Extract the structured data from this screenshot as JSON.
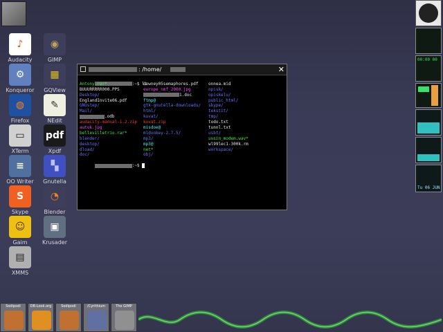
{
  "desktop": {
    "icons": [
      {
        "label": "Audacity",
        "glyph": "♪",
        "bg": "#ffffff",
        "fg": "#e05010"
      },
      {
        "label": "GIMP",
        "glyph": "◉",
        "bg": "#3d3e5a",
        "fg": "#c0a060"
      },
      {
        "label": "Konqueror",
        "glyph": "⚙",
        "bg": "#6080c0",
        "fg": "#ffffff"
      },
      {
        "label": "GQView",
        "glyph": "▦",
        "bg": "#3d3e5a",
        "fg": "#e0c020"
      },
      {
        "label": "Firefox",
        "glyph": "◍",
        "bg": "#2050a0",
        "fg": "#ff8020"
      },
      {
        "label": "NEdit",
        "glyph": "✎",
        "bg": "#f0f0e0",
        "fg": "#303030"
      },
      {
        "label": "XTerm",
        "glyph": "▭",
        "bg": "#d0d0d0",
        "fg": "#202020"
      },
      {
        "label": "Xpdf",
        "glyph": "pdf",
        "bg": "#1a1a1a",
        "fg": "#ffffff"
      },
      {
        "label": "OO Writer",
        "glyph": "≡",
        "bg": "#5070a0",
        "fg": "#ffffff"
      },
      {
        "label": "Gnutella",
        "glyph": "▚",
        "bg": "#4050c0",
        "fg": "#c0c0ff"
      },
      {
        "label": "Skype",
        "glyph": "S",
        "bg": "#f06020",
        "fg": "#ffffff"
      },
      {
        "label": "Blender",
        "glyph": "◔",
        "bg": "#3d3e5a",
        "fg": "#f08020"
      },
      {
        "label": "Gaim",
        "glyph": "☺",
        "bg": "#f0c010",
        "fg": "#503000"
      },
      {
        "label": "Krusader",
        "glyph": "▣",
        "bg": "#607080",
        "fg": "#ffffff"
      },
      {
        "label": "XMMS",
        "glyph": "▤",
        "bg": "#b0b0b0",
        "fg": "#202020"
      }
    ]
  },
  "terminal": {
    "title": ": /home/",
    "close": "✕",
    "prompt1": ":~$ ls",
    "prompt2": ":~$",
    "col1": [
      {
        "t": "Antony.rar*",
        "c": "c-green"
      },
      {
        "t": "BUUURRRRR000.PPS",
        "c": "c-white"
      },
      {
        "t": "Desktop/",
        "c": "c-blue"
      },
      {
        "t": "EnglandInvite06.pdf",
        "c": "c-white"
      },
      {
        "t": "GNUstep/",
        "c": "c-blue"
      },
      {
        "t": "Mail/",
        "c": "c-blue"
      },
      {
        "t": ".odb",
        "c": "c-white",
        "redact": true
      },
      {
        "t": "audacity-manual-1.2.zip",
        "c": "c-red"
      },
      {
        "t": "autok.jpg",
        "c": "c-mag"
      },
      {
        "t": "bellevilletrio.rar*",
        "c": "c-green"
      },
      {
        "t": "blender/",
        "c": "c-blue"
      },
      {
        "t": "desktop/",
        "c": "c-blue"
      },
      {
        "t": "dload/",
        "c": "c-blue"
      },
      {
        "t": "doc/",
        "c": "c-blue"
      }
    ],
    "col2": [
      {
        "t": "downey05semaphores.pdf",
        "c": "c-white"
      },
      {
        "t": "europe_nmf_2000.jpg",
        "c": "c-mag"
      },
      {
        "t": "1.doc",
        "c": "c-white",
        "redact": true
      },
      {
        "t": "ftmp@",
        "c": "c-cyan"
      },
      {
        "t": "gtk-gnutella-downloads/",
        "c": "c-blue"
      },
      {
        "t": "html/",
        "c": "c-blue"
      },
      {
        "t": "kuvat/",
        "c": "c-blue"
      },
      {
        "t": "kuvat.zip",
        "c": "c-red"
      },
      {
        "t": "misdoe@",
        "c": "c-cyan"
      },
      {
        "t": "mldonkey-2.7.5/",
        "c": "c-blue"
      },
      {
        "t": "mp3/",
        "c": "c-blue"
      },
      {
        "t": "mp3@",
        "c": "c-cyan"
      },
      {
        "t": "net*",
        "c": "c-green"
      },
      {
        "t": "obj/",
        "c": "c-blue"
      }
    ],
    "col3": [
      {
        "t": "onnea.mid",
        "c": "c-white"
      },
      {
        "t": "opisk/",
        "c": "c-blue"
      },
      {
        "t": "opiskelu/",
        "c": "c-blue"
      },
      {
        "t": "public_html/",
        "c": "c-blue"
      },
      {
        "t": "skype/",
        "c": "c-blue"
      },
      {
        "t": "tekstit/",
        "c": "c-blue"
      },
      {
        "t": "tmp/",
        "c": "c-blue"
      },
      {
        "t": "todo.txt",
        "c": "c-white"
      },
      {
        "t": "tunnl.txt",
        "c": "c-white"
      },
      {
        "t": "usbt/",
        "c": "c-blue"
      },
      {
        "t": "uusin_modem.wav*",
        "c": "c-green"
      },
      {
        "t": "wl99lec1-300k.rm",
        "c": "c-white"
      },
      {
        "t": "workspace/",
        "c": "c-blue"
      }
    ]
  },
  "dock": {
    "clock_time": "00:00 00",
    "date": "Tu 06 JUN"
  },
  "taskbar": {
    "items": [
      {
        "label": "Sodipodi",
        "color": "#c07030"
      },
      {
        "label": "DB-Look.org",
        "color": "#e09020"
      },
      {
        "label": "Sodipodi",
        "color": "#c07030"
      },
      {
        "label": "/Cyrithium",
        "color": "#6070a0"
      },
      {
        "label": "The GIMP",
        "color": "#909090"
      }
    ]
  }
}
